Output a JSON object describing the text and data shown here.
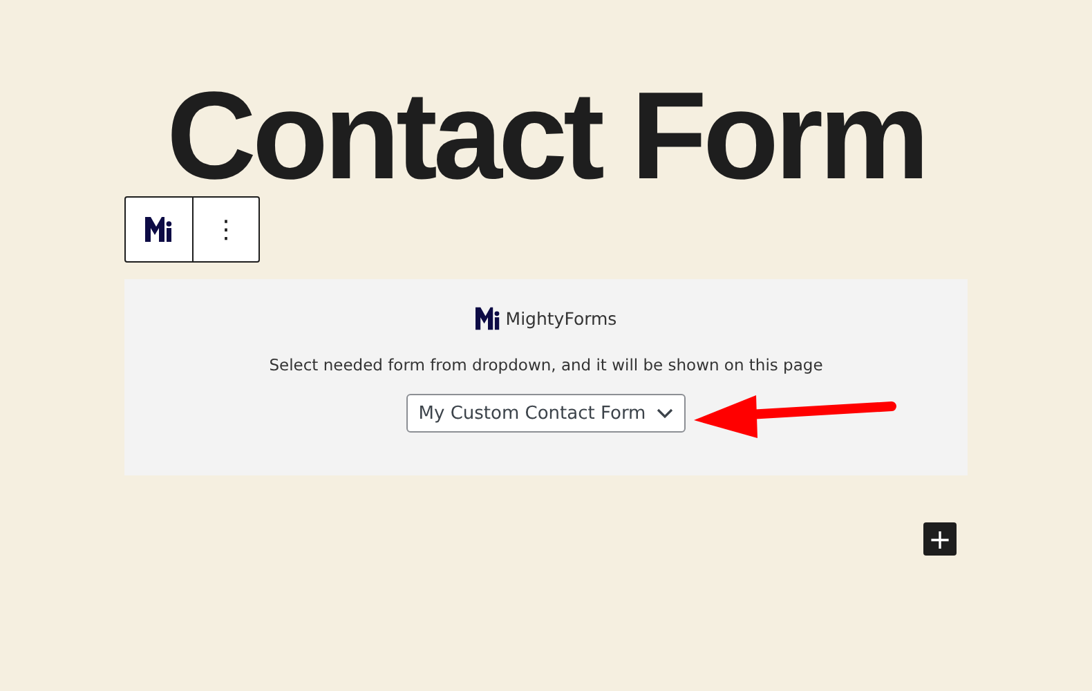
{
  "page_title": "Contact Form",
  "block_toolbar": {
    "tools": [
      {
        "kind": "logo"
      },
      {
        "kind": "more",
        "label": "⋮"
      }
    ]
  },
  "block": {
    "brand": "MightyForms",
    "instruction": "Select needed form from dropdown, and it will be shown on this page",
    "dropdown": {
      "value": "My Custom Contact Form"
    }
  },
  "add_block": {
    "label": "+"
  }
}
